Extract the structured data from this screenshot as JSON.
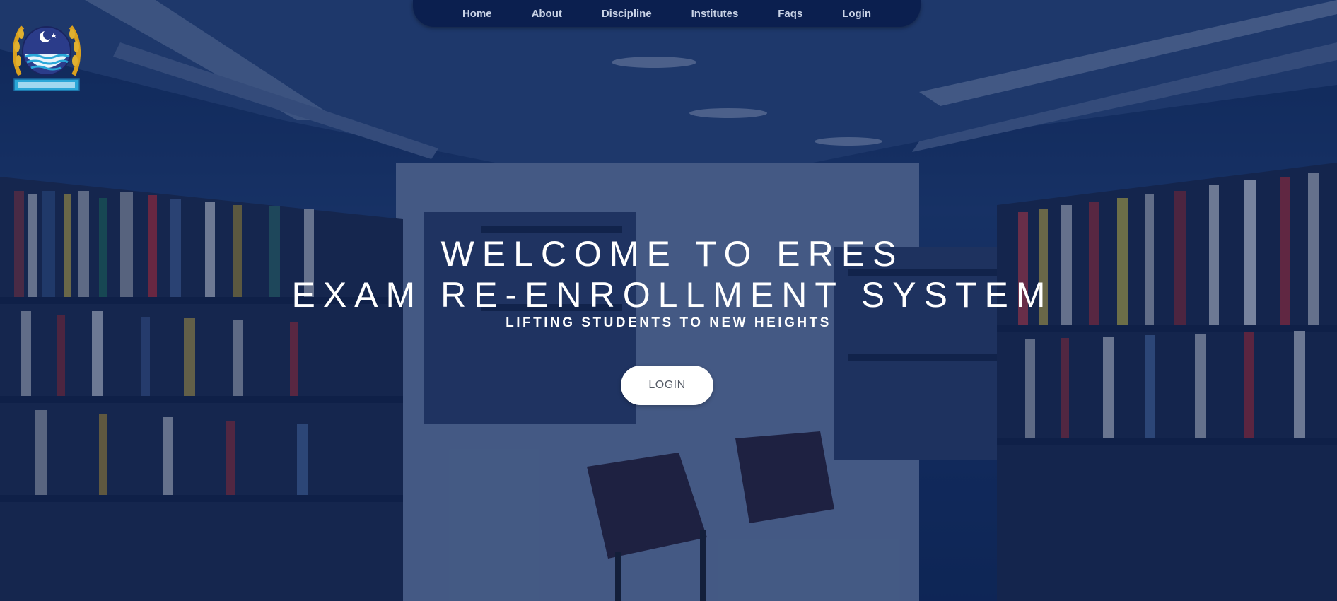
{
  "nav": {
    "items": [
      {
        "label": "Home"
      },
      {
        "label": "About"
      },
      {
        "label": "Discipline"
      },
      {
        "label": "Institutes"
      },
      {
        "label": "Faqs"
      },
      {
        "label": "Login"
      }
    ]
  },
  "logo": {
    "icon": "university-crest-icon"
  },
  "hero": {
    "line1": "WELCOME TO ERES",
    "line2": "EXAM RE-ENROLLMENT SYSTEM",
    "tagline": "LIFTING STUDENTS TO NEW HEIGHTS",
    "button_label": "LOGIN"
  },
  "colors": {
    "nav_bg": "#0b1f4f",
    "overlay": "#081e4e",
    "button_bg": "#ffffff",
    "button_text": "#555b66"
  }
}
